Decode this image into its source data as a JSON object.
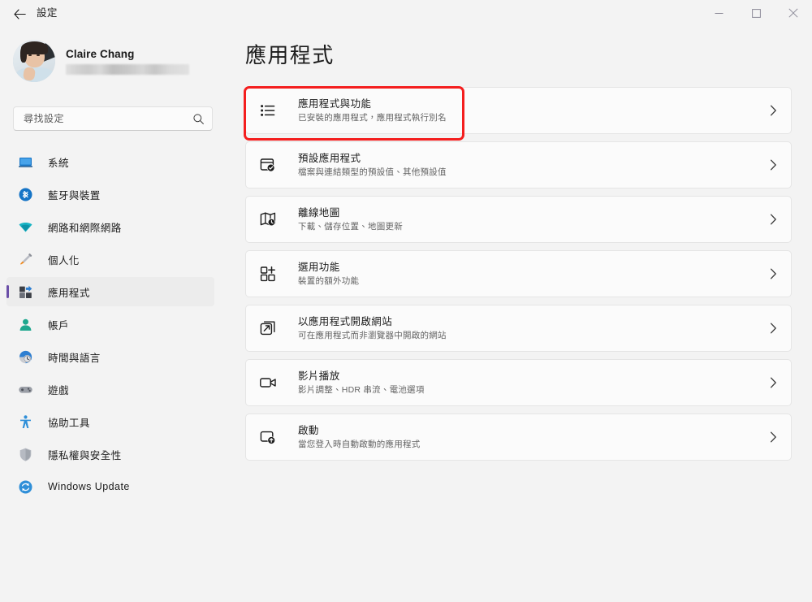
{
  "window": {
    "title": "設定",
    "back_label": "返回",
    "controls": {
      "minimize": "最小化",
      "maximize": "最大化",
      "close": "關閉"
    }
  },
  "sidebar": {
    "profile": {
      "name": "Claire Chang",
      "email_redacted": true
    },
    "search": {
      "placeholder": "尋找設定",
      "value": ""
    },
    "items": [
      {
        "label": "系統",
        "icon": "monitor-icon",
        "selected": false
      },
      {
        "label": "藍牙與裝置",
        "icon": "bluetooth-icon",
        "selected": false
      },
      {
        "label": "網路和網際網路",
        "icon": "wifi-icon",
        "selected": false
      },
      {
        "label": "個人化",
        "icon": "paintbrush-icon",
        "selected": false
      },
      {
        "label": "應用程式",
        "icon": "apps-icon",
        "selected": true
      },
      {
        "label": "帳戶",
        "icon": "account-icon",
        "selected": false
      },
      {
        "label": "時間與語言",
        "icon": "clock-globe-icon",
        "selected": false
      },
      {
        "label": "遊戲",
        "icon": "gamepad-icon",
        "selected": false
      },
      {
        "label": "協助工具",
        "icon": "accessibility-icon",
        "selected": false
      },
      {
        "label": "隱私權與安全性",
        "icon": "shield-icon",
        "selected": false
      },
      {
        "label": "Windows Update",
        "icon": "update-sync-icon",
        "selected": false
      }
    ]
  },
  "main": {
    "page_title": "應用程式",
    "cards": [
      {
        "title": "應用程式與功能",
        "subtitle": "已安裝的應用程式，應用程式執行別名",
        "icon": "list-bullets-icon",
        "highlighted": true
      },
      {
        "title": "預設應用程式",
        "subtitle": "檔案與連結類型的預設值、其他預設值",
        "icon": "window-check-icon",
        "highlighted": false
      },
      {
        "title": "離線地圖",
        "subtitle": "下載、儲存位置、地圖更新",
        "icon": "map-icon",
        "highlighted": false
      },
      {
        "title": "選用功能",
        "subtitle": "裝置的額外功能",
        "icon": "grid-plus-icon",
        "highlighted": false
      },
      {
        "title": "以應用程式開啟網站",
        "subtitle": "可在應用程式而非瀏覽器中開啟的網站",
        "icon": "external-link-icon",
        "highlighted": false
      },
      {
        "title": "影片播放",
        "subtitle": "影片調整、HDR 串流、電池選項",
        "icon": "video-camera-icon",
        "highlighted": false
      },
      {
        "title": "啟動",
        "subtitle": "當您登入時自動啟動的應用程式",
        "icon": "startup-icon",
        "highlighted": false
      }
    ],
    "chevron_glyph": "›"
  },
  "colors": {
    "window_bg": "#f3f3f3",
    "card_bg": "#fbfbfb",
    "card_border": "#e5e5e5",
    "selected_nav_bg": "#ececec",
    "accent_indicator": "#6b4fa8",
    "highlight_red": "#f41e1e",
    "text_primary": "#1b1b1b",
    "text_secondary": "#636363"
  }
}
